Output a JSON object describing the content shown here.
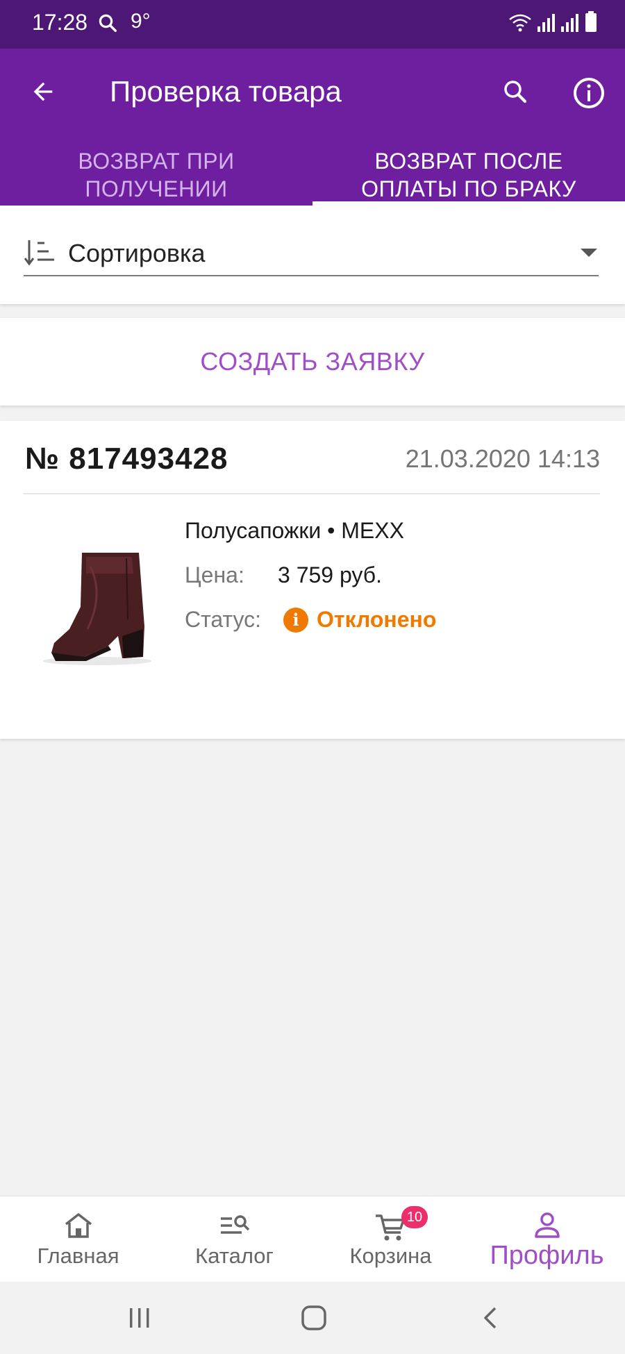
{
  "status_bar": {
    "time": "17:28",
    "temperature": "9°"
  },
  "header": {
    "title": "Проверка товара",
    "back_icon": "arrow-left-icon",
    "search_icon": "search-icon",
    "info_icon": "info-icon"
  },
  "tabs": [
    {
      "label_line1": "ВОЗВРАТ ПРИ",
      "label_line2": "ПОЛУЧЕНИИ",
      "active": false
    },
    {
      "label_line1": "ВОЗВРАТ ПОСЛЕ",
      "label_line2": "ОПЛАТЫ ПО БРАКУ",
      "active": true
    }
  ],
  "sort": {
    "label": "Сортировка"
  },
  "create_request": {
    "label": "СОЗДАТЬ ЗАЯВКУ"
  },
  "order": {
    "number": "№ 817493428",
    "date": "21.03.2020 14:13",
    "product_name": "Полусапожки • MEXX",
    "price_label": "Цена:",
    "price_value": "3 759 руб.",
    "status_label": "Статус:",
    "status_value": "Отклонено",
    "status_color": "#f07a00"
  },
  "bottom_nav": {
    "items": [
      {
        "label": "Главная",
        "icon": "home-icon"
      },
      {
        "label": "Каталог",
        "icon": "catalog-search-icon"
      },
      {
        "label": "Корзина",
        "icon": "cart-icon",
        "badge": "10"
      },
      {
        "label": "Профиль",
        "icon": "profile-icon",
        "active": true
      }
    ]
  },
  "colors": {
    "primary": "#6e1fa0",
    "status_bar": "#4d1776",
    "accent": "#a04ec6",
    "badge": "#ee2d6b"
  }
}
